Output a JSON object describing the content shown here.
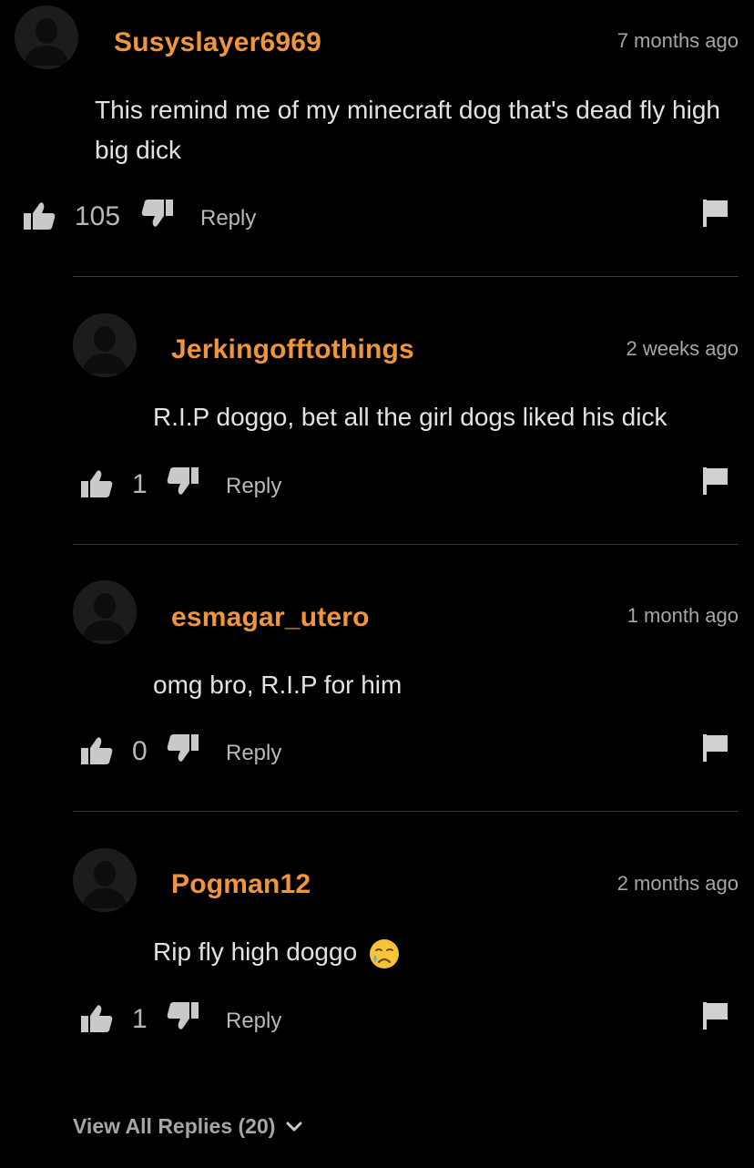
{
  "comments": [
    {
      "username": "Susyslayer6969",
      "time": "7 months ago",
      "text": "This remind me of my minecraft dog that's dead fly high big dick",
      "likes": "105",
      "reply_label": "Reply"
    },
    {
      "username": "Jerkingofftothings",
      "time": "2 weeks ago",
      "text": "R.I.P doggo, bet all the girl dogs liked his dick",
      "likes": "1",
      "reply_label": "Reply"
    },
    {
      "username": "esmagar_utero",
      "time": "1 month ago",
      "text": "omg bro, R.I.P for him",
      "likes": "0",
      "reply_label": "Reply"
    },
    {
      "username": "Pogman12",
      "time": "2 months ago",
      "text": "Rip fly high doggo",
      "likes": "1",
      "reply_label": "Reply",
      "emoji": "crying-face"
    }
  ],
  "view_all_label": "View All Replies (20)",
  "colors": {
    "background": "#000000",
    "username": "#f0953b",
    "muted": "#a6a6a6"
  }
}
